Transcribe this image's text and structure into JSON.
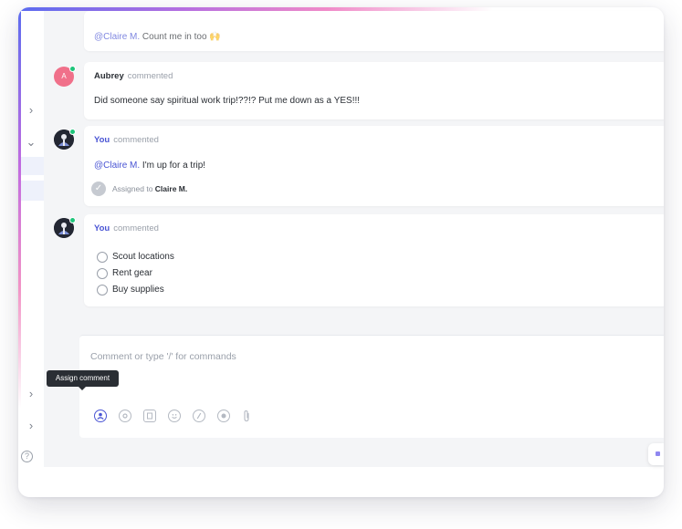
{
  "tooltip": {
    "label": "Assign comment"
  },
  "composer": {
    "placeholder": "Comment or type '/' for commands"
  },
  "comments": [
    {
      "author": "",
      "verb": "",
      "body": {
        "mention": "@Claire M.",
        "text": " Count me in too 🙌"
      }
    },
    {
      "author": "Aubrey",
      "avatar_letter": "A",
      "verb": "commented",
      "body": {
        "text": "Did someone say spiritual work trip!??!? Put me down as a YES!!!"
      }
    },
    {
      "author": "You",
      "verb": "commented",
      "body": {
        "mention": "@Claire M.",
        "text": " I'm up for a trip!"
      },
      "assigned": {
        "label": "Assigned to",
        "name": "Claire M."
      }
    },
    {
      "author": "You",
      "verb": "commented",
      "checklist": [
        "Scout locations",
        "Rent gear",
        "Buy supplies"
      ]
    }
  ],
  "sidebar": {
    "help_icon": "?"
  },
  "toolbar_icons": [
    "assign-icon",
    "mention-icon",
    "task-icon",
    "emoji-icon",
    "slash-command-icon",
    "record-icon",
    "attachment-icon"
  ],
  "colors": {
    "accent": "#4a55d4",
    "presence": "#1ec47a",
    "background": "#f4f5f7",
    "gradient_start": "#5b6cf0",
    "gradient_end": "#f08ac8"
  }
}
